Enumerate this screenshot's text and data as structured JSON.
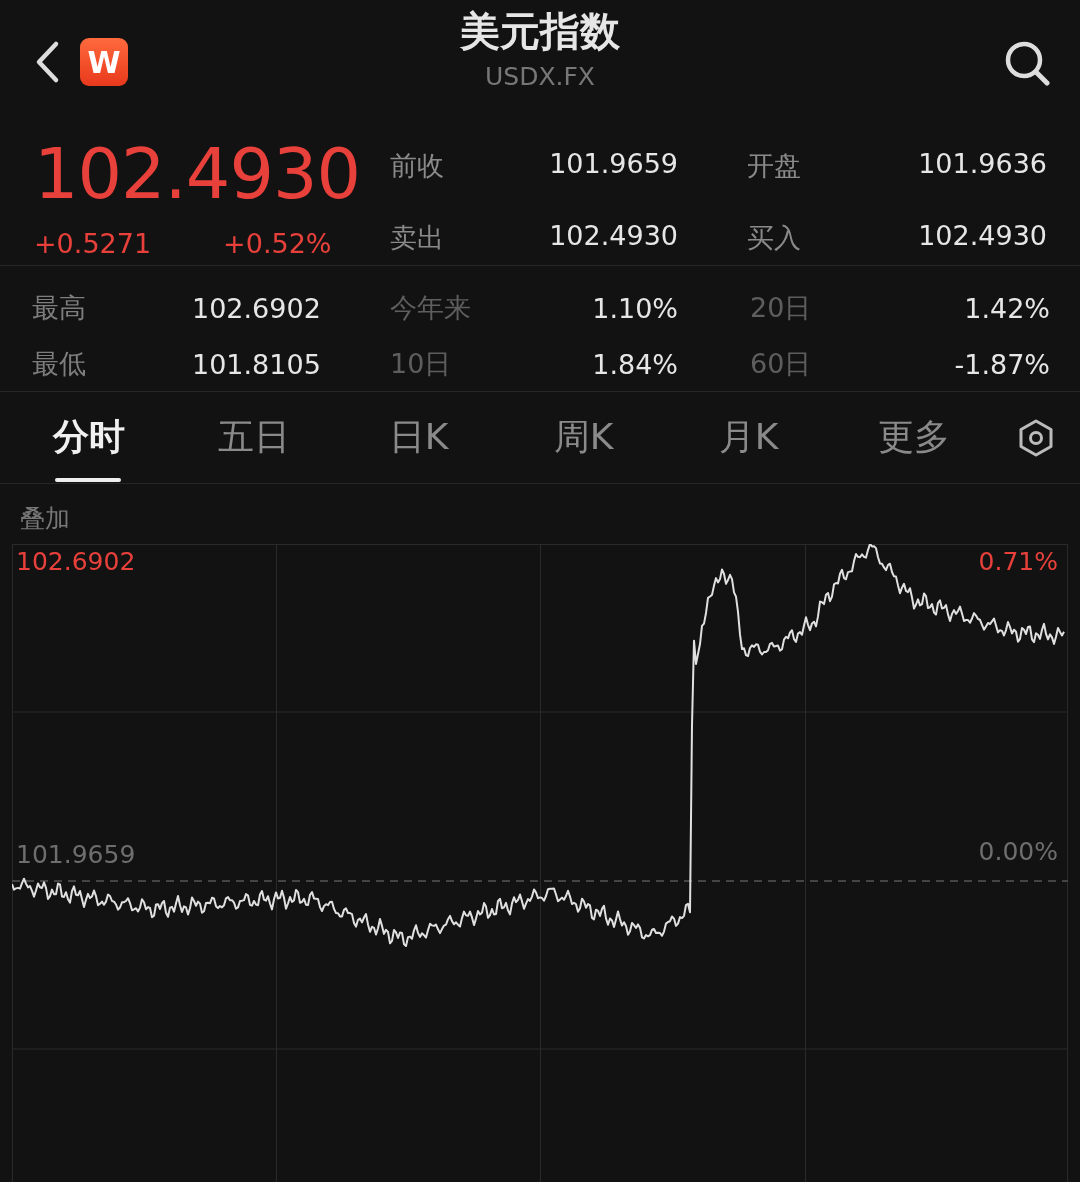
{
  "header": {
    "logo_text": "W",
    "title": "美元指数",
    "symbol": "USDX.FX"
  },
  "quote": {
    "price": "102.4930",
    "change": "+0.5271",
    "change_pct": "+0.52%",
    "fields": [
      {
        "label": "前收",
        "value": "101.9659"
      },
      {
        "label": "开盘",
        "value": "101.9636"
      },
      {
        "label": "卖出",
        "value": "102.4930"
      },
      {
        "label": "买入",
        "value": "102.4930"
      }
    ]
  },
  "stats": [
    {
      "label": "最高",
      "value": "102.6902"
    },
    {
      "label": "今年来",
      "value": "1.10%"
    },
    {
      "label": "20日",
      "value": "1.42%"
    },
    {
      "label": "最低",
      "value": "101.8105"
    },
    {
      "label": "10日",
      "value": "1.84%"
    },
    {
      "label": "60日",
      "value": "-1.87%"
    }
  ],
  "tabs": [
    {
      "label": "分时",
      "selected": true
    },
    {
      "label": "五日",
      "selected": false
    },
    {
      "label": "日K",
      "selected": false
    },
    {
      "label": "周K",
      "selected": false
    },
    {
      "label": "月K",
      "selected": false
    },
    {
      "label": "更多",
      "selected": false
    }
  ],
  "chart": {
    "overlay_label": "叠加",
    "high_price": "102.6902",
    "high_pct": "0.71%",
    "base_price": "101.9659",
    "base_pct": "0.00%"
  }
}
